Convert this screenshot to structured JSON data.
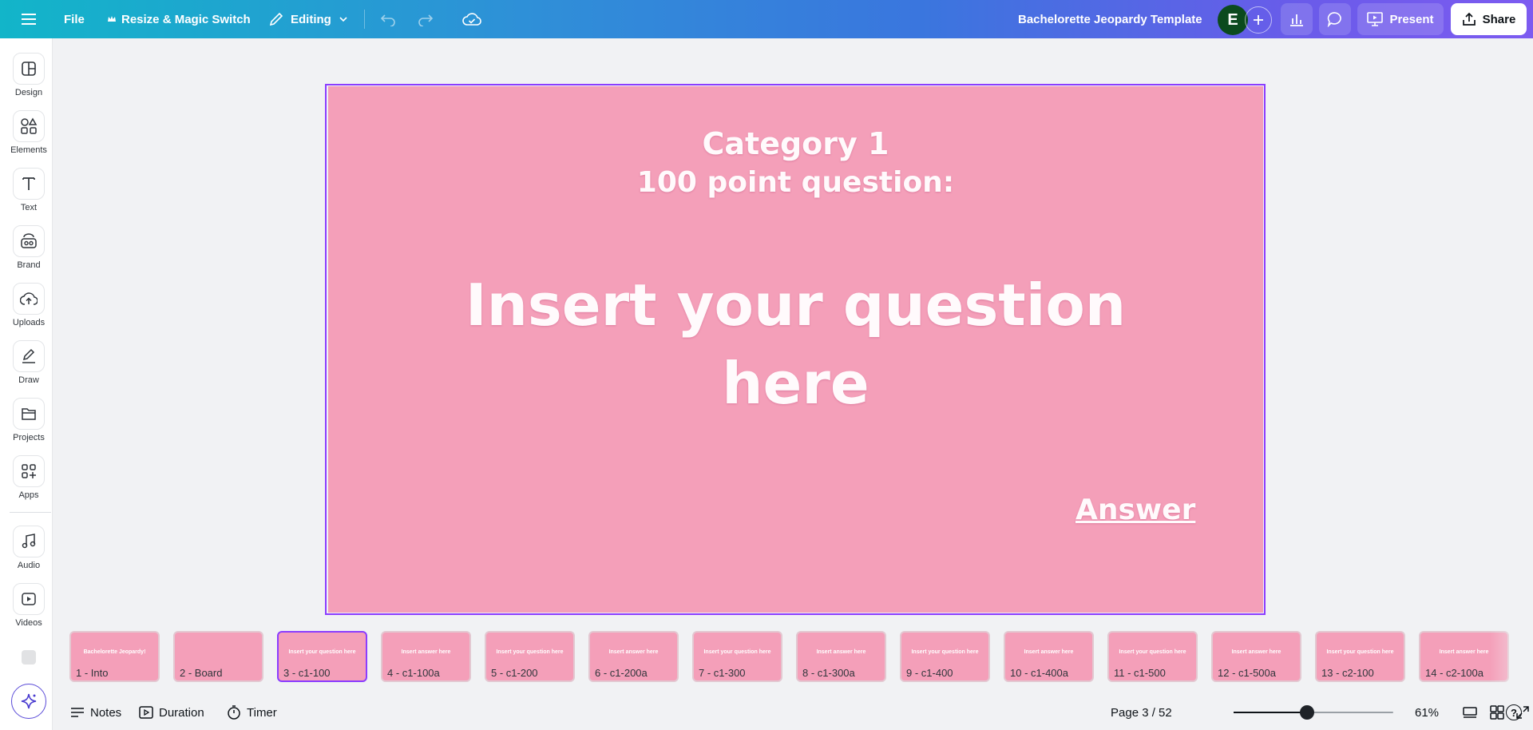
{
  "topbar": {
    "file_label": "File",
    "resize_label": "Resize & Magic Switch",
    "editing_label": "Editing",
    "doc_title": "Bachelorette Jeopardy Template",
    "avatar_initial": "E",
    "present_label": "Present",
    "share_label": "Share"
  },
  "sidebar": {
    "items": [
      {
        "label": "Design",
        "icon": "layout-icon"
      },
      {
        "label": "Elements",
        "icon": "shapes-icon"
      },
      {
        "label": "Text",
        "icon": "text-icon"
      },
      {
        "label": "Brand",
        "icon": "brand-icon"
      },
      {
        "label": "Uploads",
        "icon": "cloud-upload-icon"
      },
      {
        "label": "Draw",
        "icon": "pen-icon"
      },
      {
        "label": "Projects",
        "icon": "folder-icon"
      },
      {
        "label": "Apps",
        "icon": "apps-icon"
      },
      {
        "label": "Audio",
        "icon": "music-icon"
      },
      {
        "label": "Videos",
        "icon": "video-icon"
      }
    ]
  },
  "slide": {
    "category": "Category 1",
    "points": "100 point question:",
    "question_line1": "Insert your question",
    "question_line2": "here",
    "answer_link": "Answer",
    "background": "#f49fb9"
  },
  "filmstrip": {
    "thumbs": [
      {
        "label": "1 - Into",
        "mini": "Bachelorette Jeopardy!"
      },
      {
        "label": "2 - Board",
        "mini": ""
      },
      {
        "label": "3 - c1-100",
        "mini": "Insert your question here"
      },
      {
        "label": "4 - c1-100a",
        "mini": "Insert answer here"
      },
      {
        "label": "5 - c1-200",
        "mini": "Insert your question here"
      },
      {
        "label": "6 - c1-200a",
        "mini": "Insert answer here"
      },
      {
        "label": "7 - c1-300",
        "mini": "Insert your question here"
      },
      {
        "label": "8 - c1-300a",
        "mini": "Insert answer here"
      },
      {
        "label": "9 - c1-400",
        "mini": "Insert your question here"
      },
      {
        "label": "10 - c1-400a",
        "mini": "Insert answer here"
      },
      {
        "label": "11 - c1-500",
        "mini": "Insert your question here"
      },
      {
        "label": "12 - c1-500a",
        "mini": "Insert answer here"
      },
      {
        "label": "13 - c2-100",
        "mini": "Insert your question here"
      },
      {
        "label": "14 - c2-100a",
        "mini": "Insert answer here"
      }
    ],
    "active_index": 2
  },
  "bottombar": {
    "notes_label": "Notes",
    "duration_label": "Duration",
    "timer_label": "Timer",
    "page_indicator": "Page 3 / 52",
    "zoom_label": "61%",
    "zoom_fraction": 0.46
  }
}
